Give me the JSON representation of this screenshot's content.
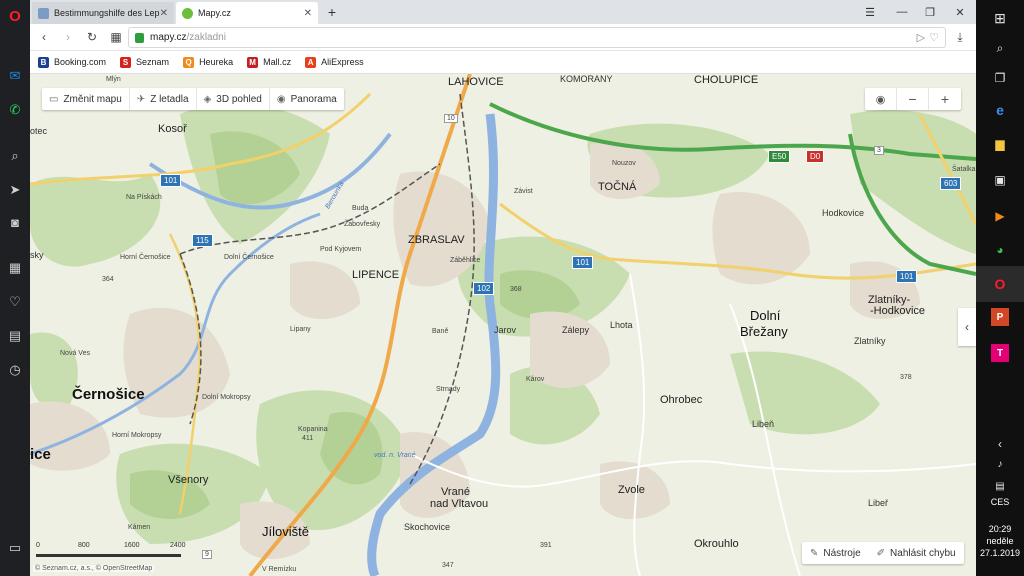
{
  "browser": {
    "tabs": [
      {
        "title": "Bestimmungshilfe des Lep",
        "active": false,
        "favicon_color": "#7a9cc6"
      },
      {
        "title": "Mapy.cz",
        "active": true,
        "favicon_color": "#6bbf3c"
      }
    ],
    "new_tab": "+",
    "url_host": "mapy.cz",
    "url_path": "/zakladni"
  },
  "bookmarks": [
    {
      "label": "Booking.com",
      "letter": "B",
      "color": "#1d3f8f"
    },
    {
      "label": "Seznam",
      "letter": "S",
      "color": "#d4211c"
    },
    {
      "label": "Heureka",
      "letter": "Q",
      "color": "#f08a1c"
    },
    {
      "label": "Mall.cz",
      "letter": "M",
      "color": "#c51f26"
    },
    {
      "label": "AliExpress",
      "letter": "A",
      "color": "#e8401a"
    }
  ],
  "map_toolbar": {
    "change_map": "Změnit mapu",
    "flight": "Z letadla",
    "view3d": "3D pohled",
    "panorama": "Panorama"
  },
  "zoom": {
    "minus": "−",
    "plus": "+"
  },
  "bottom_tools": {
    "tools": "Nástroje",
    "report": "Nahlásit chybu"
  },
  "scale_ticks": [
    "0",
    "800",
    "1600",
    "2400"
  ],
  "copyright": "© Seznam.cz, a.s., © OpenStreetMap",
  "places": {
    "cernosice": "Černošice",
    "ice": "ice",
    "zbraslav": "ZBRASLAV",
    "lipence": "LIPENCE",
    "tocna": "TOČNÁ",
    "dolni": "Dolní",
    "brezany": "Břežany",
    "jiloviste": "Jíloviště",
    "vrane": "Vrané",
    "nad_vltavou": "nad Vltavou",
    "zvole": "Zvole",
    "ohrobec": "Ohrobec",
    "okrouhlo": "Okrouhlo",
    "zlatniky": "Zlatníky-",
    "hodkovice": "-Hodkovice",
    "kosor": "Kosoř",
    "vsenory": "Všenory",
    "lahovice": "LAHOVICE",
    "cholupice": "CHOLUPICE",
    "komorany": "KOMORANY",
    "hodkovice2": "Hodkovice",
    "zlatniky2": "Zlatníky",
    "libero": "Libeř",
    "liben": "Libeň",
    "lhota": "Lhota",
    "zalepy": "Zálepy",
    "jarov": "Jarov",
    "karov": "Károv",
    "bane": "Baně",
    "strnady": "Strnady",
    "skochovice": "Skochovice",
    "lipany": "Lipany",
    "nouzov": "Nouzov",
    "zavist": "Závist",
    "buda": "Buda",
    "zabovresky": "Záběhlice",
    "zabehlice": "Záběhlice",
    "zabovresky2": "Žabovřesky",
    "pod_kyjovem": "Pod Kyjovem",
    "dolni_cernosice": "Dolní Černošice",
    "horni_cernosice": "Horní Černošice",
    "dolni_mokropsy": "Dolní Mokropsy",
    "horni_mokropsy": "Horní Mokropsy",
    "nova_vraz": "Nová Ves",
    "na_piskach": "Na Pískách",
    "kamen": "Kámen",
    "kopanina": "Kopanina",
    "kopanina_h": "411",
    "botec": "otec",
    "sky": "sky",
    "satalka": "Šatalka",
    "mlyn": "Mlýn",
    "remizku": "V Remízku",
    "vod_vrane": "vod. n. Vrané",
    "berounka": "Berounka",
    "h368": "368",
    "h364": "364",
    "h378": "378",
    "h391": "391",
    "h347": "347"
  },
  "road_shields": {
    "r101a": "101",
    "r101b": "101",
    "r101c": "101",
    "r115": "115",
    "r102": "102",
    "r603": "603",
    "e50": "E50",
    "d0": "D0",
    "exit10": "10",
    "exit3": "3",
    "exit9": "9"
  },
  "taskbar": {
    "time": "20:29",
    "day": "neděle",
    "date": "27.1.2019",
    "lang": "CES"
  }
}
